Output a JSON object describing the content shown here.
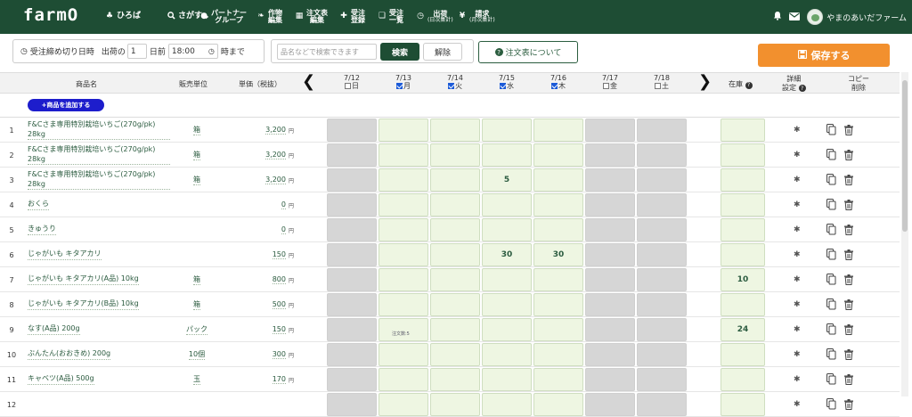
{
  "nav": {
    "logo": "farmO",
    "items": [
      {
        "icon": "tree-icon",
        "label": "ひろば"
      },
      {
        "icon": "search-icon",
        "label": "さがす",
        "caret": "›"
      },
      {
        "icon": "person-icon",
        "line1": "パートナー",
        "line2": "グループ"
      },
      {
        "icon": "leaf-icon",
        "line1": "作物",
        "line2": "編集"
      },
      {
        "icon": "grid-icon",
        "line1": "注文表",
        "line2": "編集"
      },
      {
        "icon": "cart-icon",
        "line1": "受注",
        "line2": "登録"
      },
      {
        "icon": "list-icon",
        "line1": "受注",
        "line2": "一覧"
      },
      {
        "icon": "clock-icon",
        "line1": "出荷",
        "line2": "(日次集計)"
      },
      {
        "icon": "yen-icon",
        "line1": "請求",
        "line2": "(月次集計)"
      }
    ],
    "farm_name": "やまのあいだファーム"
  },
  "toolbar": {
    "deadline_label": "受注締め切り日時",
    "ship_prefix": "出荷の",
    "days_value": "1",
    "days_suffix": "日前",
    "time_value": "18:00",
    "time_suffix": "時まで",
    "search_placeholder": "品名などで検索できます",
    "search_button": "検索",
    "clear_button": "解除",
    "about_button": "注文表について",
    "save_button": "保存する"
  },
  "table": {
    "headers": {
      "product": "商品名",
      "unit": "販売単位",
      "price": "単価（税抜）",
      "stock": "在庫",
      "detail_line1": "詳細",
      "detail_line2": "設定",
      "copy_line1": "コピー",
      "copy_line2": "削除"
    },
    "add_button": "+商品を追加する",
    "days": [
      {
        "date": "7/12",
        "dow": "日",
        "checked": false
      },
      {
        "date": "7/13",
        "dow": "月",
        "checked": true
      },
      {
        "date": "7/14",
        "dow": "火",
        "checked": true
      },
      {
        "date": "7/15",
        "dow": "水",
        "checked": true
      },
      {
        "date": "7/16",
        "dow": "木",
        "checked": true
      },
      {
        "date": "7/17",
        "dow": "金",
        "checked": false
      },
      {
        "date": "7/18",
        "dow": "土",
        "checked": false
      }
    ],
    "rows": [
      {
        "idx": "1",
        "name": "F&Cさま専用特別栽培いちご(270g/pk) 28kg",
        "unit": "箱",
        "price": "3,200",
        "cells": [
          "",
          "",
          "",
          "",
          ""
        ],
        "stock": "",
        "note": ""
      },
      {
        "idx": "2",
        "name": "F&Cさま専用特別栽培いちご(270g/pk) 28kg",
        "unit": "箱",
        "price": "3,200",
        "cells": [
          "",
          "",
          "",
          "",
          ""
        ],
        "stock": "",
        "note": ""
      },
      {
        "idx": "3",
        "name": "F&Cさま専用特別栽培いちご(270g/pk) 28kg",
        "unit": "箱",
        "price": "3,200",
        "cells": [
          "",
          "",
          "",
          "5",
          ""
        ],
        "stock": "",
        "note": ""
      },
      {
        "idx": "4",
        "name": "おくら",
        "unit": "",
        "price": "0",
        "cells": [
          "",
          "",
          "",
          "",
          ""
        ],
        "stock": "",
        "note": ""
      },
      {
        "idx": "5",
        "name": "きゅうり",
        "unit": "",
        "price": "0",
        "cells": [
          "",
          "",
          "",
          "",
          ""
        ],
        "stock": "",
        "note": ""
      },
      {
        "idx": "6",
        "name": "じゃがいも キタアカリ",
        "unit": "",
        "price": "150",
        "cells": [
          "",
          "",
          "",
          "30",
          "30"
        ],
        "stock": "",
        "note": ""
      },
      {
        "idx": "7",
        "name": "じゃがいも キタアカリ(A品) 10kg",
        "unit": "箱",
        "price": "800",
        "cells": [
          "",
          "",
          "",
          "",
          ""
        ],
        "stock": "10",
        "note": ""
      },
      {
        "idx": "8",
        "name": "じゃがいも キタアカリ(B品) 10kg",
        "unit": "箱",
        "price": "500",
        "cells": [
          "",
          "",
          "",
          "",
          ""
        ],
        "stock": "",
        "note": ""
      },
      {
        "idx": "9",
        "name": "なす(A品) 200g",
        "unit": "パック",
        "price": "150",
        "cells": [
          "",
          "",
          "",
          "",
          ""
        ],
        "stock": "24",
        "note": "注文数:5"
      },
      {
        "idx": "10",
        "name": "ぶんたん(おおきめ) 200g",
        "unit": "10個",
        "price": "300",
        "cells": [
          "",
          "",
          "",
          "",
          ""
        ],
        "stock": "",
        "note": ""
      },
      {
        "idx": "11",
        "name": "キャベツ(A品) 500g",
        "unit": "玉",
        "price": "170",
        "cells": [
          "",
          "",
          "",
          "",
          ""
        ],
        "stock": "",
        "note": ""
      },
      {
        "idx": "12",
        "name": "",
        "unit": "",
        "price": "",
        "cells": [
          "",
          "",
          "",
          "",
          ""
        ],
        "stock": "",
        "note": ""
      }
    ],
    "currency": "円"
  },
  "colors": {
    "nav_bg": "#1e4d34",
    "save_bg": "#f2902e",
    "add_bg": "#1d1dcc",
    "cell_green": "#eef6e2",
    "cell_gray": "#d6d6d6"
  }
}
